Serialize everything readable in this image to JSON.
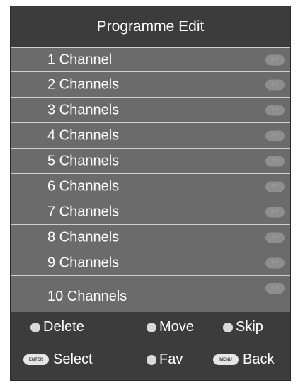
{
  "title": "Programme Edit",
  "channels": [
    {
      "label": "1 Channel"
    },
    {
      "label": "2 Channels"
    },
    {
      "label": "3 Channels"
    },
    {
      "label": "4 Channels"
    },
    {
      "label": "5 Channels"
    },
    {
      "label": "6 Channels"
    },
    {
      "label": "7 Channels"
    },
    {
      "label": "8 Channels"
    },
    {
      "label": "9 Channels"
    },
    {
      "label": "10 Channels"
    }
  ],
  "channel_type_badge": "DTV",
  "footer": {
    "delete": {
      "label": "Delete",
      "icon": "dot-icon"
    },
    "move": {
      "label": "Move",
      "icon": "dot-icon"
    },
    "skip": {
      "label": "Skip",
      "icon": "dot-icon"
    },
    "select": {
      "label": "Select",
      "key": "ENTER"
    },
    "fav": {
      "label": "Fav",
      "icon": "dot-icon"
    },
    "back": {
      "label": "Back",
      "key": "MENU"
    }
  },
  "colors": {
    "background": "#3c3c3c",
    "row": "#6b6b6b",
    "text": "#ffffff",
    "button_dot": "#d9d9d9"
  }
}
